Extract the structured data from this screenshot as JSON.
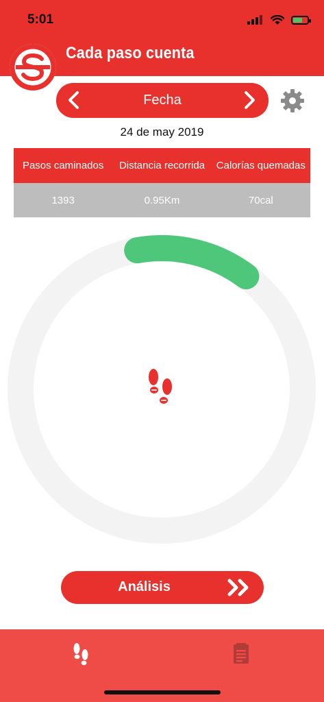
{
  "status_bar": {
    "time": "5:01"
  },
  "header": {
    "title": "Cada paso cuenta"
  },
  "date_nav": {
    "label": "Fecha",
    "date": "24 de may 2019"
  },
  "stats": {
    "headers": [
      "Pasos caminados",
      "Distancia recorrida",
      "Calorías quemadas"
    ],
    "values": [
      "1393",
      "0.95Km",
      "70cal"
    ]
  },
  "progress": {
    "fraction": 0.13,
    "track_color": "#f3f3f3",
    "fill_color": "#4fc77a"
  },
  "analysis": {
    "label": "Análisis"
  },
  "tabs": [
    {
      "icon": "footprints-icon"
    },
    {
      "icon": "report-icon"
    }
  ],
  "colors": {
    "brand": "#e8302c",
    "tab_bar": "#ef4c47",
    "table_body": "#bdbdbd"
  }
}
